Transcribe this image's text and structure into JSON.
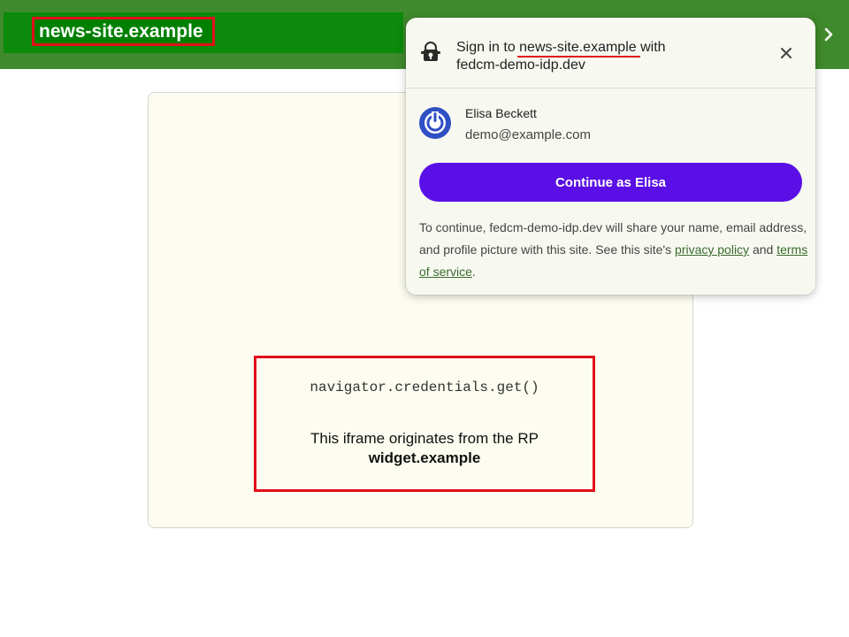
{
  "header": {
    "site_title": "news-site.example"
  },
  "dialog": {
    "title_prefix": "Sign in to ",
    "rp_domain": "news-site.example",
    "title_middle": " with",
    "idp_domain": "fedcm-demo-idp.dev",
    "close_label": "×",
    "account": {
      "name": "Elisa Beckett",
      "email": "demo@example.com"
    },
    "continue_label": "Continue as Elisa",
    "disclosure_text": "To continue, fedcm-demo-idp.dev will share your name, email address, and profile picture with this site. See this site's ",
    "privacy_link": "privacy policy",
    "and_text": " and ",
    "terms_link": "terms of service",
    "period": ".",
    "button_color": "#5a0fe6"
  },
  "iframe": {
    "code": "navigator.credentials.get()",
    "note_line1": "This iframe originates from the RP",
    "note_line2": "widget.example"
  },
  "colors": {
    "header_bg": "#3f8a2c",
    "highlight_red": "#e0101a",
    "card_bg": "#fdfcf0"
  }
}
